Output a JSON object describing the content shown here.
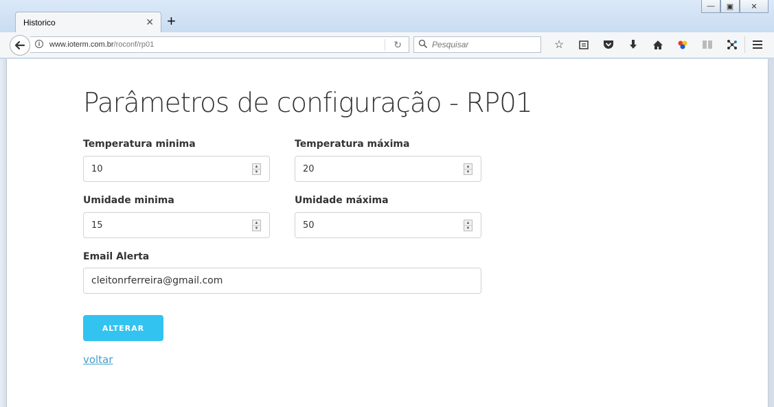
{
  "browser": {
    "tab_title": "Historico",
    "url_host": "www.ioterm.com.br",
    "url_path": "/roconf/rp01",
    "search_placeholder": "Pesquisar"
  },
  "page": {
    "title": "Parâmetros de configuração - RP01",
    "fields": {
      "temp_min": {
        "label": "Temperatura minima",
        "value": "10"
      },
      "temp_max": {
        "label": "Temperatura máxima",
        "value": "20"
      },
      "hum_min": {
        "label": "Umidade minima",
        "value": "15"
      },
      "hum_max": {
        "label": "Umidade máxima",
        "value": "50"
      },
      "email": {
        "label": "Email Alerta",
        "value": "cleitonrferreira@gmail.com"
      }
    },
    "submit_label": "ALTERAR",
    "back_link": "voltar"
  },
  "colors": {
    "button": "#33c3f0",
    "link": "#3f9fd0"
  }
}
